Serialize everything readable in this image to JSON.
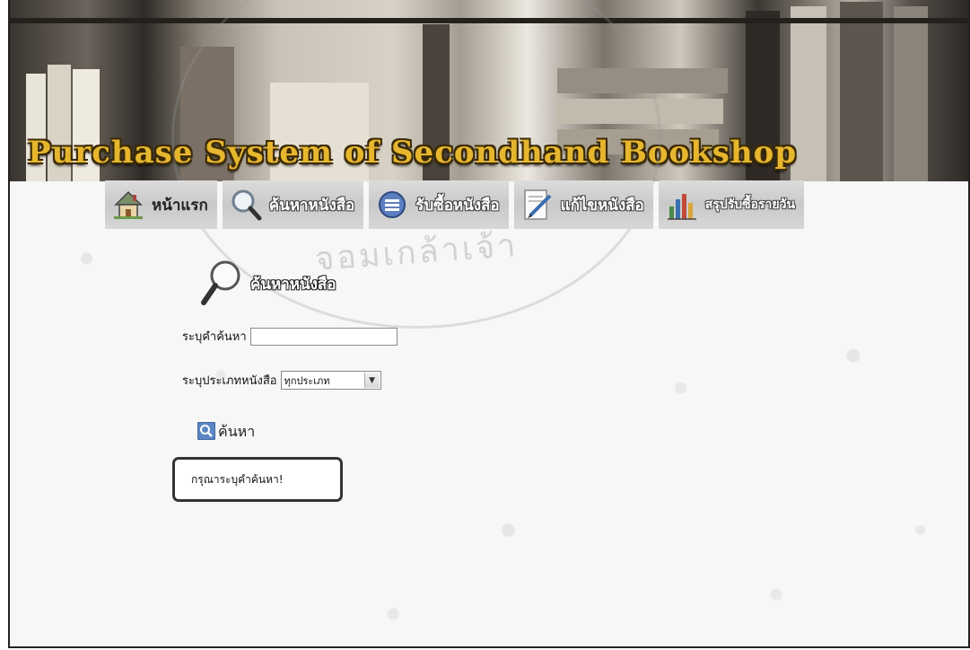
{
  "banner": {
    "title": "Purchase System of Secondhand Bookshop"
  },
  "nav": [
    {
      "label": "หน้าแรก",
      "icon": "house-icon"
    },
    {
      "label": "ค้นหาหนังสือ",
      "icon": "magnifier-icon"
    },
    {
      "label": "รับซื้อหนังสือ",
      "icon": "list-circle-icon"
    },
    {
      "label": "แก้ไขหนังสือ",
      "icon": "pencil-icon"
    },
    {
      "label": "สรุปรับซื้อรายวัน",
      "icon": "bar-chart-icon"
    }
  ],
  "search": {
    "heading": "ค้นหาหนังสือ",
    "keyword_label": "ระบุคำค้นหา",
    "keyword_value": "",
    "type_label": "ระบุประเภทหนังสือ",
    "type_selected": "ทุกประเภท",
    "button_label": "ค้นหา"
  },
  "message": "กรุณาระบุคำค้นหา!",
  "watermark": "จอมเกล้าเจ้า",
  "colors": {
    "title": "#e6b62e",
    "nav_bg": "#d3d3d3"
  }
}
